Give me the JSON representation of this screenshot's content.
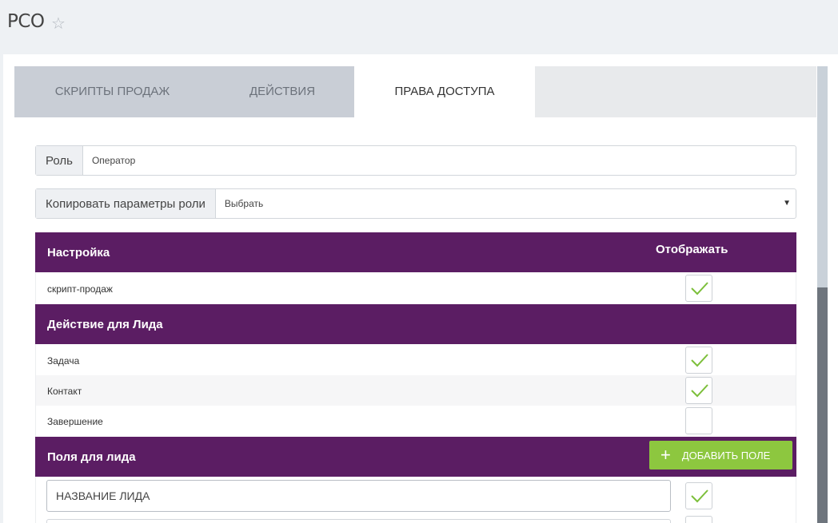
{
  "app": {
    "title": "РСО",
    "favorite_icon": "star-outline-icon"
  },
  "tabs": [
    {
      "label": "Скрипты продаж",
      "active": false
    },
    {
      "label": "Действия",
      "active": false
    },
    {
      "label": "Права доступа",
      "active": true
    }
  ],
  "role": {
    "label": "Роль",
    "value": "Оператор"
  },
  "copy_role": {
    "label": "Копировать параметры роли",
    "selected": "Выбрать"
  },
  "settings_section": {
    "title": "Настройка",
    "column": "Отображать",
    "rows": [
      {
        "label": "скрипт-продаж",
        "checked": true
      }
    ]
  },
  "lead_actions_section": {
    "title": "Действие для Лида",
    "rows": [
      {
        "label": "Задача",
        "checked": true
      },
      {
        "label": "Контакт",
        "checked": true
      },
      {
        "label": "Завершение",
        "checked": false
      }
    ]
  },
  "lead_fields_section": {
    "title": "Поля для лида",
    "add_button": "Добавить поле",
    "fields": [
      {
        "value": "Название лида",
        "checked": true
      }
    ]
  },
  "colors": {
    "accent": "#5b1d63",
    "success": "#8dc73f",
    "check": "#7cbf3a"
  }
}
